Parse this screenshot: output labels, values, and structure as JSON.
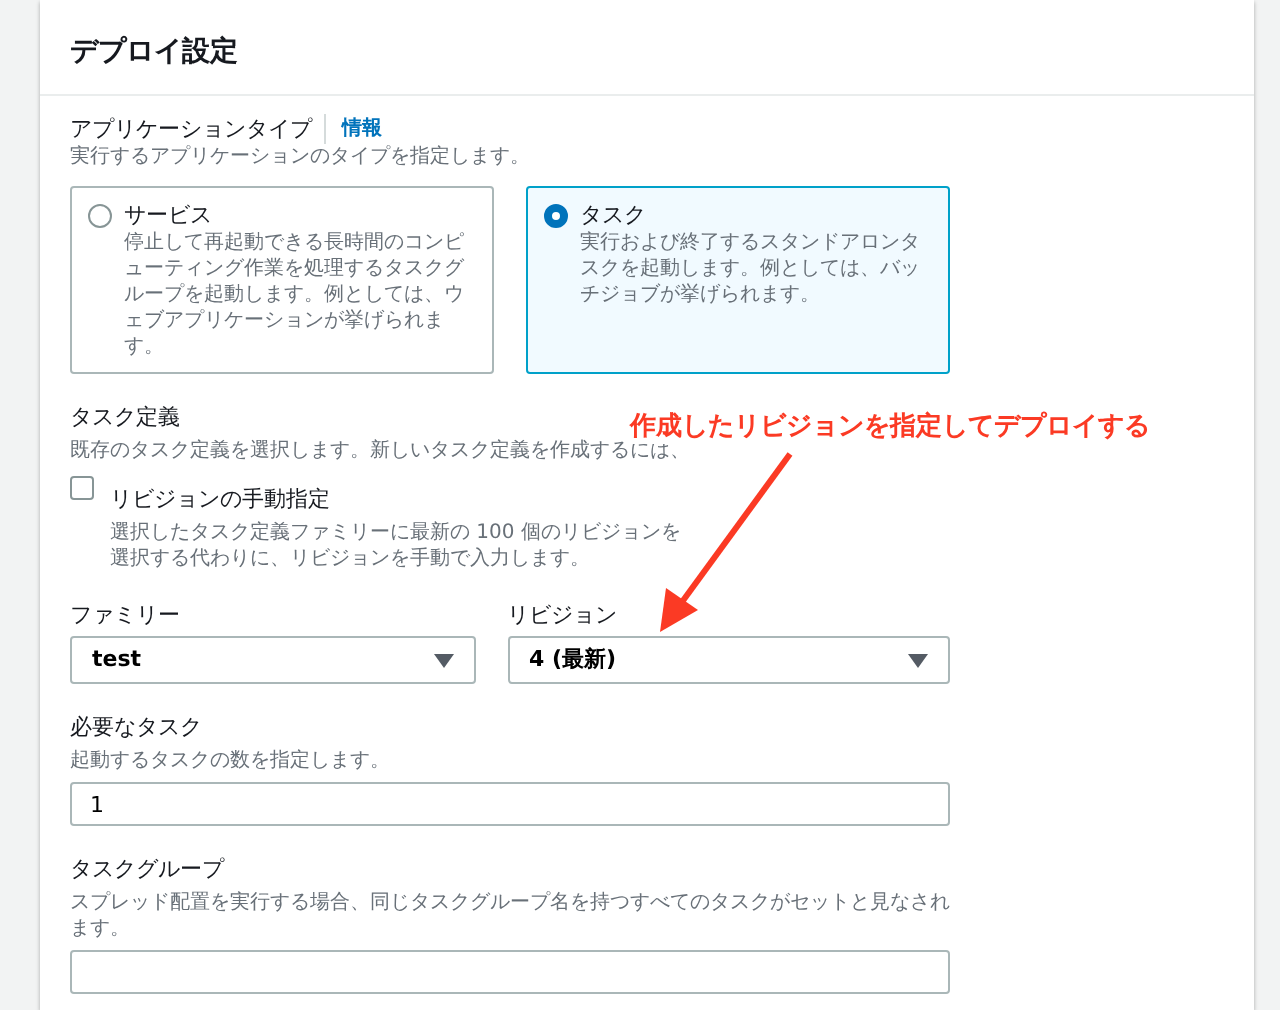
{
  "header": {
    "title": "デプロイ設定"
  },
  "application_type": {
    "label": "アプリケーションタイプ",
    "info_link": "情報",
    "description": "実行するアプリケーションのタイプを指定します。",
    "options": [
      {
        "title": "サービス",
        "description": "停止して再起動できる長時間のコンピューティング作業を処理するタスクグループを起動します。例としては、ウェブアプリケーションが挙げられます。",
        "selected": false
      },
      {
        "title": "タスク",
        "description": "実行および終了するスタンドアロンタスクを起動します。例としては、バッチジョブが挙げられます。",
        "selected": true
      }
    ]
  },
  "task_definition": {
    "label": "タスク定義",
    "description": "既存のタスク定義を選択します。新しいタスク定義を作成するには、",
    "manual_revision": {
      "label": "リビジョンの手動指定",
      "checked": false,
      "description": "選択したタスク定義ファミリーに最新の 100 個のリビジョンを選択する代わりに、リビジョンを手動で入力します。"
    },
    "family": {
      "label": "ファミリー",
      "value": "test"
    },
    "revision": {
      "label": "リビジョン",
      "value": "4 (最新)"
    }
  },
  "desired_tasks": {
    "label": "必要なタスク",
    "description": "起動するタスクの数を指定します。",
    "value": "1"
  },
  "task_group": {
    "label": "タスクグループ",
    "description": "スプレッド配置を実行する場合、同じタスクグループ名を持つすべてのタスクがセットと見なされます。"
  },
  "annotation": {
    "text": "作成したリビジョンを指定してデプロイする"
  }
}
